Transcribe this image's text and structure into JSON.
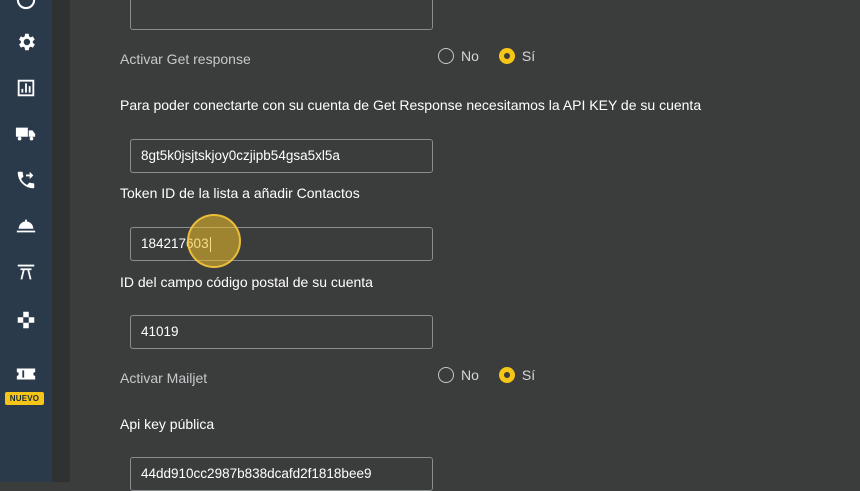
{
  "sidebar": {
    "items": [
      {
        "icon": "clock-icon"
      },
      {
        "icon": "gear-icon"
      },
      {
        "icon": "report-icon"
      },
      {
        "icon": "truck-icon"
      },
      {
        "icon": "phone-forward-icon"
      },
      {
        "icon": "service-bell-icon"
      },
      {
        "icon": "arch-icon"
      },
      {
        "icon": "puzzle-icon"
      },
      {
        "icon": "ticket-icon"
      }
    ],
    "new_badge": "NUEVO"
  },
  "form": {
    "get_response": {
      "label": "Activar Get response",
      "option_no": "No",
      "option_si": "Sí",
      "selected": "Sí"
    },
    "api_key_help": "Para poder conectarte con su cuenta de Get Response necesitamos la API KEY de su cuenta",
    "api_key_value": "8gt5k0jsjtskjoy0czjipb54gsa5xl5a",
    "token_label": "Token ID de la lista a añadir Contactos",
    "token_value": "184217603",
    "postal_label": "ID del campo código postal de su cuenta",
    "postal_value": "41019",
    "mailjet": {
      "label": "Activar Mailjet",
      "option_no": "No",
      "option_si": "Sí",
      "selected": "Sí"
    },
    "public_key_label": "Api key pública",
    "public_key_value": "44dd910cc2987b838dcafd2f1818bee9"
  },
  "colors": {
    "accent": "#f5c518",
    "sidebar": "#2b3a4b",
    "background": "#3b3c3c"
  }
}
